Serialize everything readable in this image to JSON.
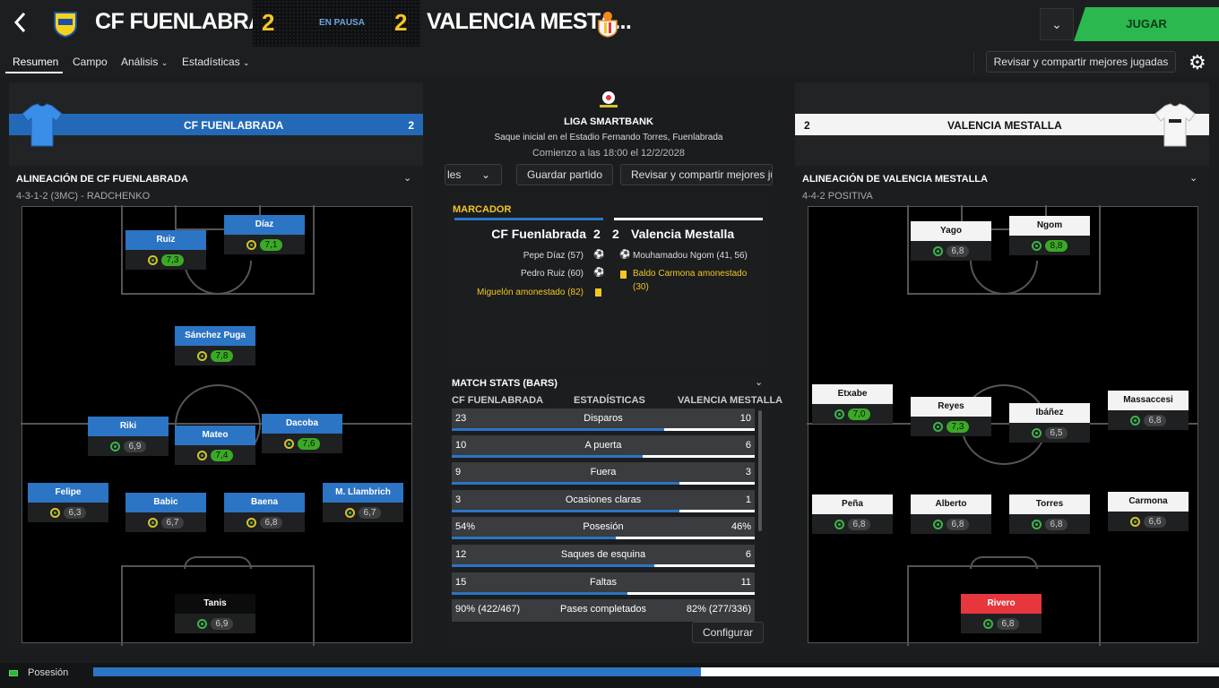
{
  "header": {
    "home_team": "CF FUENLABRADA",
    "away_team": "VALENCIA MESTA...",
    "home_score": "2",
    "away_score": "2",
    "status": "EN PAUSA",
    "play_button": "JUGAR"
  },
  "nav": {
    "tabs": [
      "Resumen",
      "Campo",
      "Análisis",
      "Estadísticas"
    ],
    "review_button": "Revisar y compartir mejores jugadas"
  },
  "home_panel": {
    "team_name": "CF FUENLABRADA",
    "score": "2",
    "lineup_title": "ALINEACIÓN DE CF FUENLABRADA",
    "formation": "4-3-1-2 (3MC) - RADCHENKO",
    "players": [
      {
        "name": "Díaz",
        "rating": "7,1",
        "good": true
      },
      {
        "name": "Ruiz",
        "rating": "7,3",
        "good": true
      },
      {
        "name": "Sánchez Puga",
        "rating": "7,8",
        "good": true
      },
      {
        "name": "Riki",
        "rating": "6,9",
        "good": false
      },
      {
        "name": "Dacoba",
        "rating": "7,6",
        "good": true
      },
      {
        "name": "Mateo",
        "rating": "7,4",
        "good": true
      },
      {
        "name": "Felipe",
        "rating": "6,3",
        "good": false
      },
      {
        "name": "Babic",
        "rating": "6,7",
        "good": false
      },
      {
        "name": "Baena",
        "rating": "6,8",
        "good": false
      },
      {
        "name": "M. Llambrich",
        "rating": "6,7",
        "good": false
      },
      {
        "name": "Tanis",
        "rating": "6,9",
        "good": false
      }
    ]
  },
  "away_panel": {
    "team_name": "VALENCIA MESTALLA",
    "score": "2",
    "lineup_title": "ALINEACIÓN DE VALENCIA MESTALLA",
    "formation": "4-4-2 POSITIVA",
    "players": [
      {
        "name": "Yago",
        "rating": "6,8",
        "good": false
      },
      {
        "name": "Ngom",
        "rating": "8,8",
        "good": true
      },
      {
        "name": "Etxabe",
        "rating": "7,0",
        "good": true
      },
      {
        "name": "Reyes",
        "rating": "7,3",
        "good": true
      },
      {
        "name": "Ibáñez",
        "rating": "6,5",
        "good": false
      },
      {
        "name": "Massaccesi",
        "rating": "6,8",
        "good": false
      },
      {
        "name": "Peña",
        "rating": "6,8",
        "good": false
      },
      {
        "name": "Alberto",
        "rating": "6,8",
        "good": false
      },
      {
        "name": "Torres",
        "rating": "6,8",
        "good": false
      },
      {
        "name": "Carmona",
        "rating": "6,6",
        "good": false
      },
      {
        "name": "Rivero",
        "rating": "6,8",
        "good": false
      }
    ]
  },
  "match_info": {
    "league": "LIGA SMARTBANK",
    "kickoff": "Saque inicial en el Estadio Fernando Torres, Fuenlabrada",
    "start": "Comienzo a las 18:00 el 12/2/2028",
    "dropdown_label": "les",
    "save_button": "Guardar partido",
    "review_button": "Revisar y compartir mejores ju"
  },
  "scoreboard": {
    "title": "MARCADOR",
    "home": "CF Fuenlabrada",
    "home_score": "2",
    "away_score": "2",
    "away": "Valencia Mestalla",
    "home_events": [
      "Pepe Díaz (57)",
      "Pedro Ruiz (60)",
      "Miguelón amonestado (82)"
    ],
    "away_events": [
      "Mouhamadou Ngom (41, 56)",
      "Baldo Carmona amonestado",
      "(30)"
    ]
  },
  "stats": {
    "title": "MATCH STATS (BARS)",
    "col_home": "CF FUENLABRADA",
    "col_mid": "ESTADÍSTICAS",
    "col_away": "VALENCIA MESTALLA",
    "rows": [
      {
        "label": "Disparos",
        "home": "23",
        "away": "10",
        "home_share": 0.7
      },
      {
        "label": "A puerta",
        "home": "10",
        "away": "6",
        "home_share": 0.63
      },
      {
        "label": "Fuera",
        "home": "9",
        "away": "3",
        "home_share": 0.75
      },
      {
        "label": "Ocasiones claras",
        "home": "3",
        "away": "1",
        "home_share": 0.75
      },
      {
        "label": "Posesión",
        "home": "54%",
        "away": "46%",
        "home_share": 0.54
      },
      {
        "label": "Saques de esquina",
        "home": "12",
        "away": "6",
        "home_share": 0.67
      },
      {
        "label": "Faltas",
        "home": "15",
        "away": "11",
        "home_share": 0.58
      },
      {
        "label": "Pases completados",
        "home": "90% (422/467)",
        "away": "82% (277/336)",
        "home_share": 0.52
      }
    ],
    "configure": "Configurar"
  },
  "footer": {
    "possession_label": "Posesión",
    "home_possession": 0.54
  }
}
